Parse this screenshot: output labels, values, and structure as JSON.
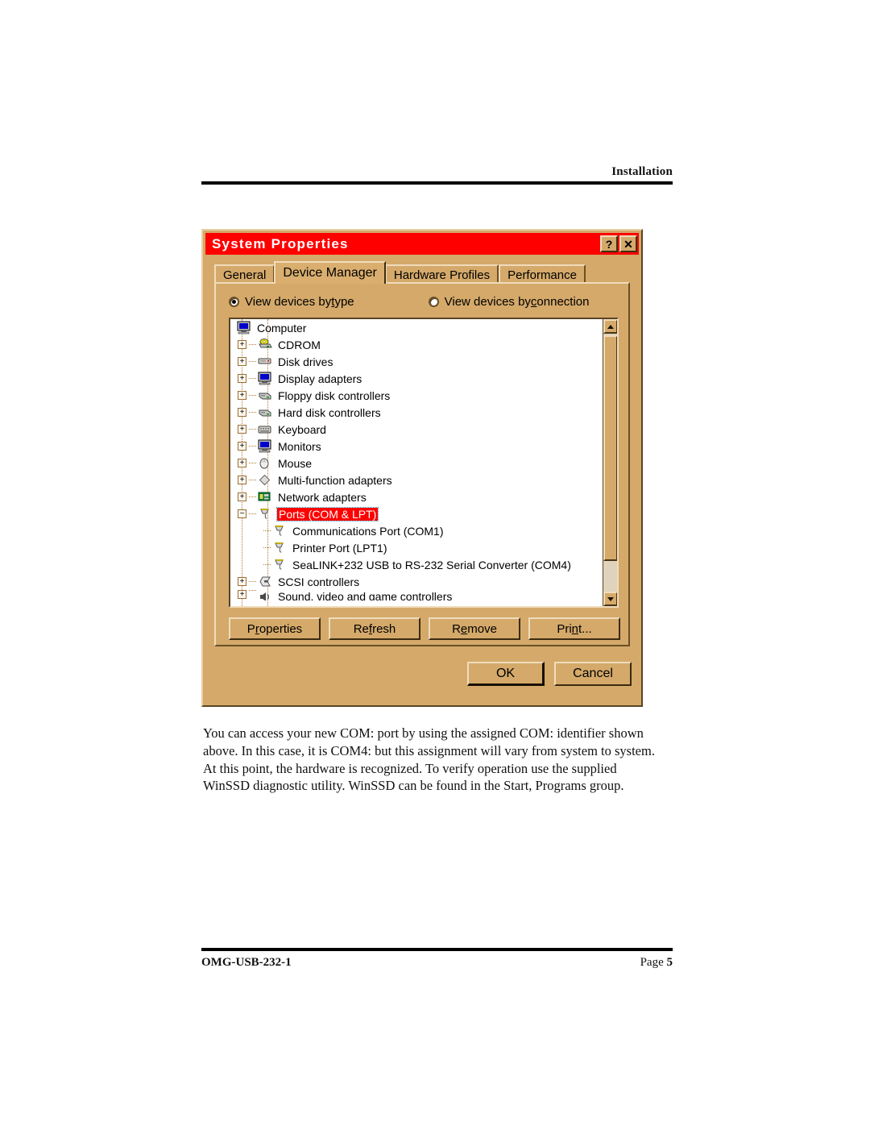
{
  "page": {
    "header_title": "Installation",
    "footer_left": "OMG-USB-232-1",
    "footer_page_label": "Page ",
    "footer_page_number": "5",
    "body_paragraph": "You can access your new COM: port by using the assigned COM: identifier shown above. In this case, it is COM4: but this assignment will vary from system to system.  At this point, the hardware is recognized. To verify operation use the supplied WinSSD diagnostic utility.  WinSSD can be found in the Start, Programs group."
  },
  "dialog": {
    "title": "System Properties",
    "titlebar_color": "#ff0000",
    "face_color": "#d4a96a",
    "help_button": "?",
    "close_button": "✕",
    "tabs": [
      {
        "label": "General",
        "active": false
      },
      {
        "label": "Device Manager",
        "active": true
      },
      {
        "label": "Hardware Profiles",
        "active": false
      },
      {
        "label": "Performance",
        "active": false
      }
    ],
    "view_options": [
      {
        "label_pre": "View devices by ",
        "accel": "t",
        "label_post": "ype",
        "selected": true
      },
      {
        "label_pre": "View devices by ",
        "accel": "c",
        "label_post": "onnection",
        "selected": false
      }
    ],
    "tree": {
      "selection_color": "#ff0000",
      "items": [
        {
          "label": "Computer",
          "level": 0,
          "expander": "none",
          "icon": "computer-icon",
          "selected": false
        },
        {
          "label": "CDROM",
          "level": 0,
          "expander": "plus",
          "icon": "cdrom-icon",
          "selected": false
        },
        {
          "label": "Disk drives",
          "level": 0,
          "expander": "plus",
          "icon": "disk-drive-icon",
          "selected": false
        },
        {
          "label": "Display adapters",
          "level": 0,
          "expander": "plus",
          "icon": "display-adapter-icon",
          "selected": false
        },
        {
          "label": "Floppy disk controllers",
          "level": 0,
          "expander": "plus",
          "icon": "floppy-controller-icon",
          "selected": false
        },
        {
          "label": "Hard disk controllers",
          "level": 0,
          "expander": "plus",
          "icon": "hard-disk-controller-icon",
          "selected": false
        },
        {
          "label": "Keyboard",
          "level": 0,
          "expander": "plus",
          "icon": "keyboard-icon",
          "selected": false
        },
        {
          "label": "Monitors",
          "level": 0,
          "expander": "plus",
          "icon": "monitor-icon",
          "selected": false
        },
        {
          "label": "Mouse",
          "level": 0,
          "expander": "plus",
          "icon": "mouse-icon",
          "selected": false
        },
        {
          "label": "Multi-function adapters",
          "level": 0,
          "expander": "plus",
          "icon": "multifunction-adapter-icon",
          "selected": false
        },
        {
          "label": "Network adapters",
          "level": 0,
          "expander": "plus",
          "icon": "network-adapter-icon",
          "selected": false
        },
        {
          "label": "Ports (COM & LPT)",
          "level": 0,
          "expander": "minus",
          "icon": "port-icon",
          "selected": true
        },
        {
          "label": "Communications Port (COM1)",
          "level": 1,
          "expander": "none",
          "icon": "port-icon",
          "selected": false
        },
        {
          "label": "Printer Port (LPT1)",
          "level": 1,
          "expander": "none",
          "icon": "port-icon",
          "selected": false
        },
        {
          "label": "SeaLINK+232 USB to RS-232 Serial Converter (COM4)",
          "level": 1,
          "expander": "none",
          "icon": "port-icon",
          "selected": false
        },
        {
          "label": "SCSI controllers",
          "level": 0,
          "expander": "plus",
          "icon": "scsi-controller-icon",
          "selected": false
        },
        {
          "label": "Sound, video and game controllers",
          "level": 0,
          "expander": "plus",
          "icon": "sound-controller-icon",
          "selected": false,
          "clipped": true
        }
      ]
    },
    "action_buttons": [
      {
        "label_pre": "P",
        "accel": "r",
        "label_post": "operties"
      },
      {
        "label_pre": "Re",
        "accel": "f",
        "label_post": "resh"
      },
      {
        "label_pre": "R",
        "accel": "e",
        "label_post": "move"
      },
      {
        "label_pre": "Pri",
        "accel": "n",
        "label_post": "t..."
      }
    ],
    "dialog_buttons": [
      {
        "label": "OK",
        "default": true
      },
      {
        "label": "Cancel",
        "default": false
      }
    ],
    "scrollbar": {
      "up_arrow": "▲",
      "down_arrow": "▼"
    }
  }
}
